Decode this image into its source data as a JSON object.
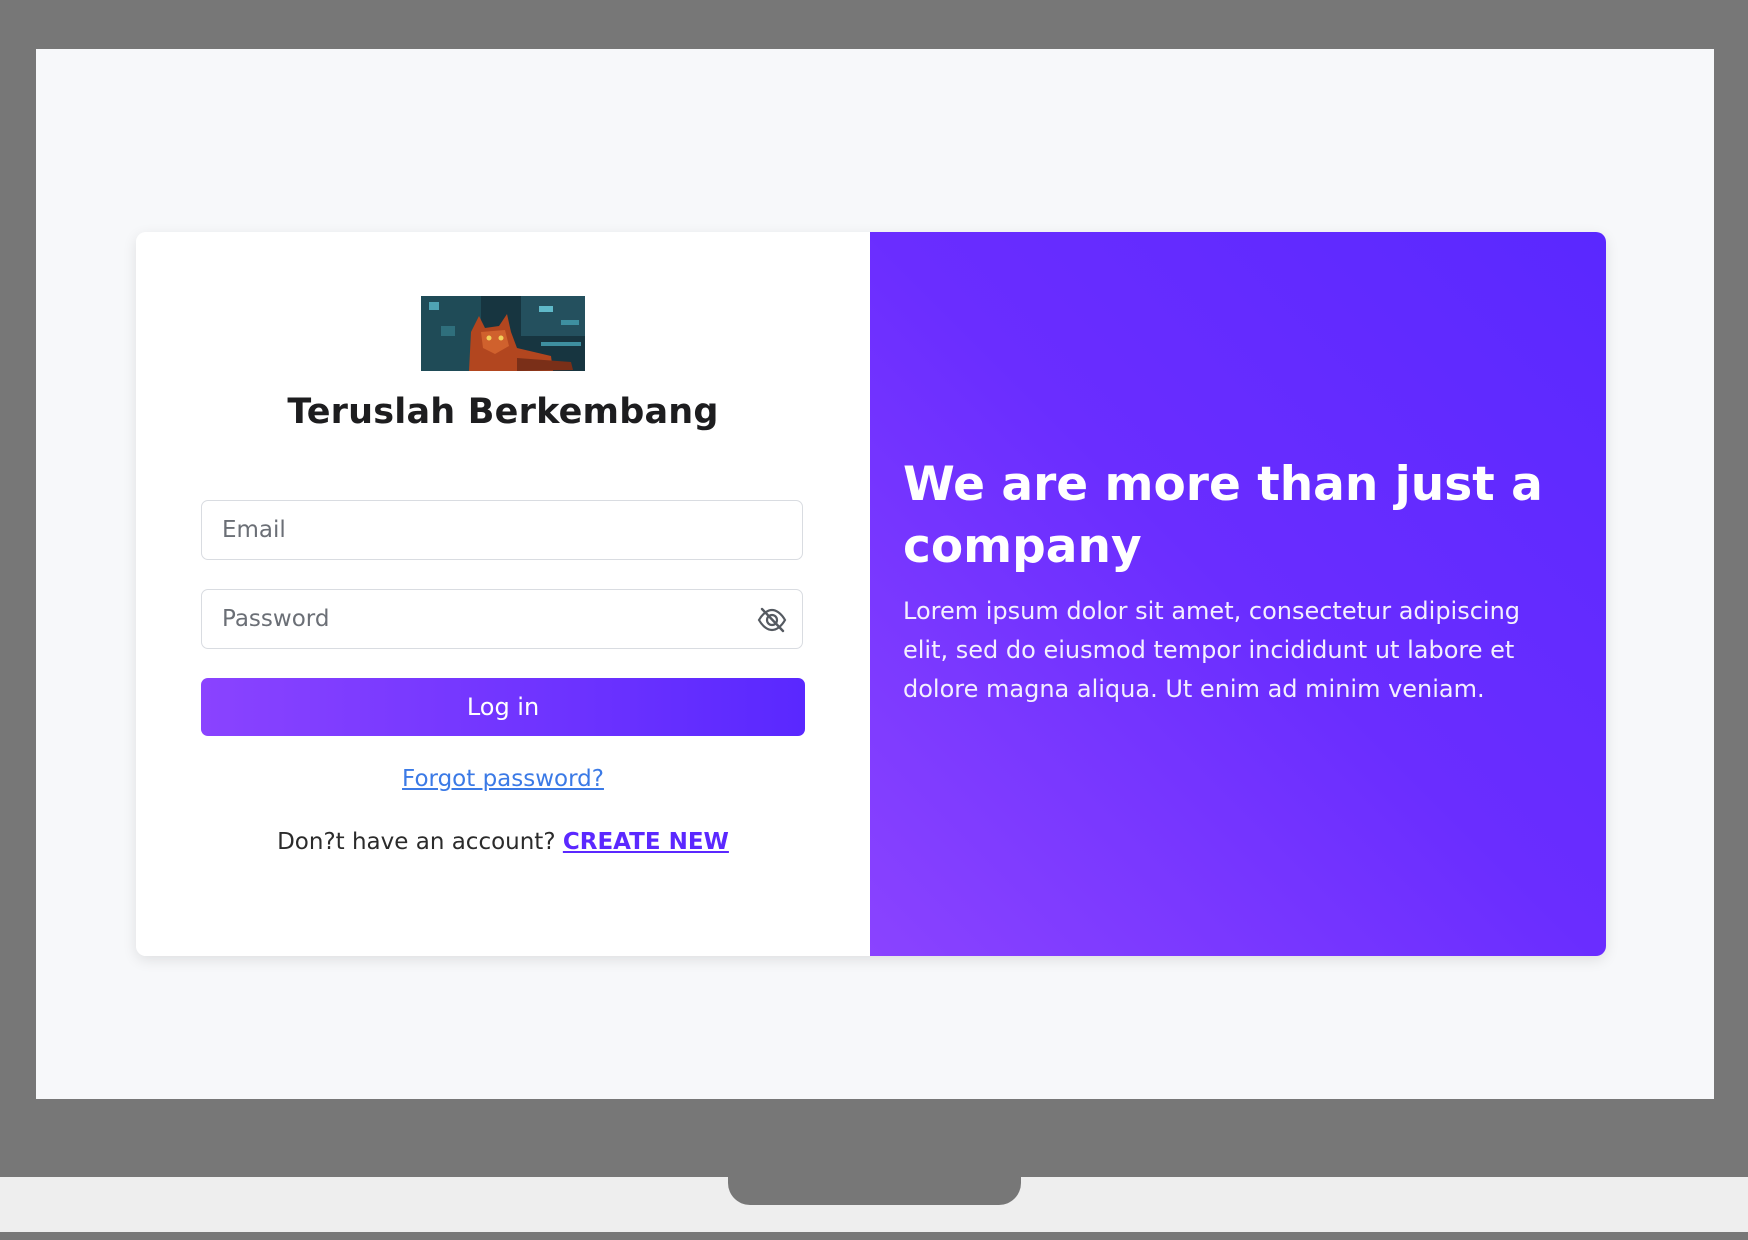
{
  "login": {
    "logo_icon": "cat-image",
    "brand_title": "Teruslah Berkembang",
    "email_placeholder": "Email",
    "email_value": "",
    "password_placeholder": "Password",
    "password_value": "",
    "password_toggle_icon": "eye-off-icon",
    "login_label": "Log in",
    "forgot_label": "Forgot password?",
    "signup_prompt": "Don?t have an account?",
    "signup_link": "CREATE NEW"
  },
  "promo": {
    "heading": "We are more than just a company",
    "body": "Lorem ipsum dolor sit amet, consectetur adipiscing elit, sed do eiusmod tempor incididunt ut labore et dolore magna aliqua. Ut enim ad minim veniam."
  },
  "colors": {
    "accent_start": "#8a43ff",
    "accent_end": "#5a28ff",
    "link": "#3b7ae6",
    "frame": "#777777",
    "screen": "#f7f8fa"
  }
}
